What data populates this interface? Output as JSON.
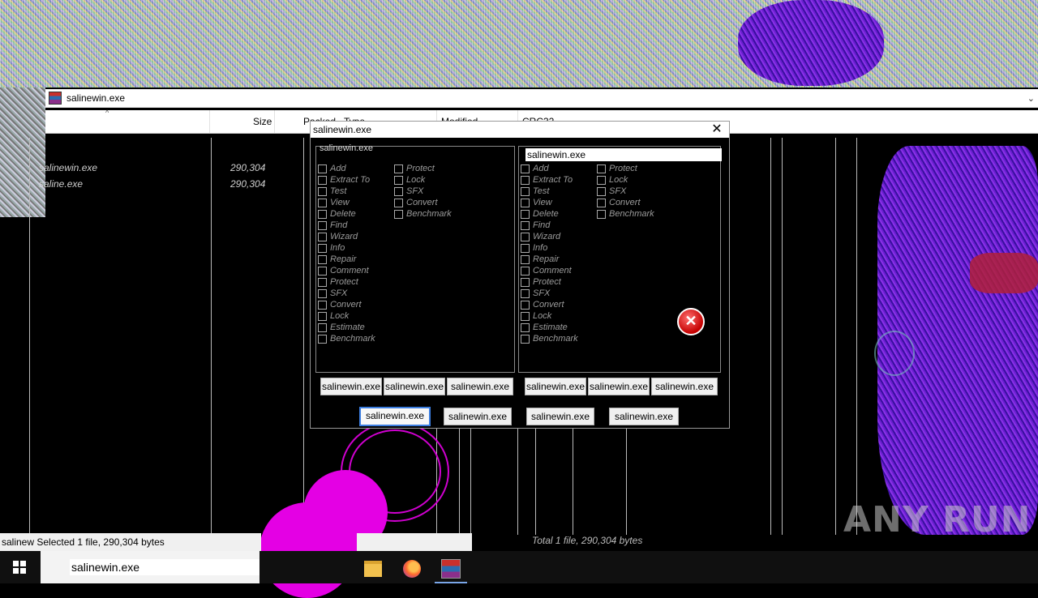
{
  "main_window": {
    "title": "salinewin.exe",
    "columns": [
      "Size",
      "Packed",
      "Type",
      "Modified",
      "CRC32"
    ],
    "files": [
      {
        "name": "salinewin.exe",
        "size": "290,304"
      },
      {
        "name": "saline.exe",
        "size": "290,304"
      }
    ]
  },
  "dialog": {
    "title": "salinewin.exe",
    "pane_left_header": "salinewin.exe",
    "pane_right_header": "salinewin.exe",
    "options_col1": [
      "Add",
      "Extract To",
      "Test",
      "View",
      "Delete",
      "Find",
      "Wizard",
      "Info",
      "Repair",
      "Comment",
      "Protect",
      "SFX",
      "Convert",
      "Lock",
      "Estimate",
      "Benchmark"
    ],
    "options_col2": [
      "Protect",
      "Lock",
      "SFX",
      "Convert",
      "Benchmark"
    ],
    "pane_buttons": [
      "salinewin.exe",
      "salinewin.exe",
      "salinewin.exe"
    ],
    "bottom_buttons": [
      "salinewin.exe",
      "salinewin.exe",
      "salinewin.exe",
      "salinewin.exe"
    ],
    "close_label": "✕",
    "error_glyph": "✕"
  },
  "status": {
    "left": "salinew Selected 1 file, 290,304 bytes",
    "right": "Total 1 file, 290,304 bytes"
  },
  "taskbar": {
    "search_value": "salinewin.exe",
    "icons": [
      "start-icon",
      "file-explorer-icon",
      "firefox-icon",
      "winrar-icon"
    ]
  },
  "watermark": "ANY RUN"
}
